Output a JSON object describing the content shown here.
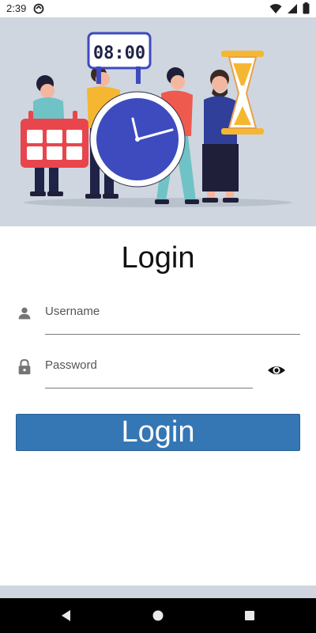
{
  "status": {
    "time": "2:39"
  },
  "illustration": {
    "timer_text": "08:00"
  },
  "login": {
    "title": "Login",
    "username_placeholder": "Username",
    "password_placeholder": "Password",
    "button_label": "Login"
  },
  "colors": {
    "accent": "#3576b4",
    "hero_background": "#cfd6df",
    "clock_face": "#3d4bbf"
  },
  "icons": {
    "username": "person-icon",
    "password": "lock-icon",
    "visibility": "eye-icon",
    "nav_back": "back-icon",
    "nav_home": "home-icon",
    "nav_recent": "recent-apps-icon"
  }
}
